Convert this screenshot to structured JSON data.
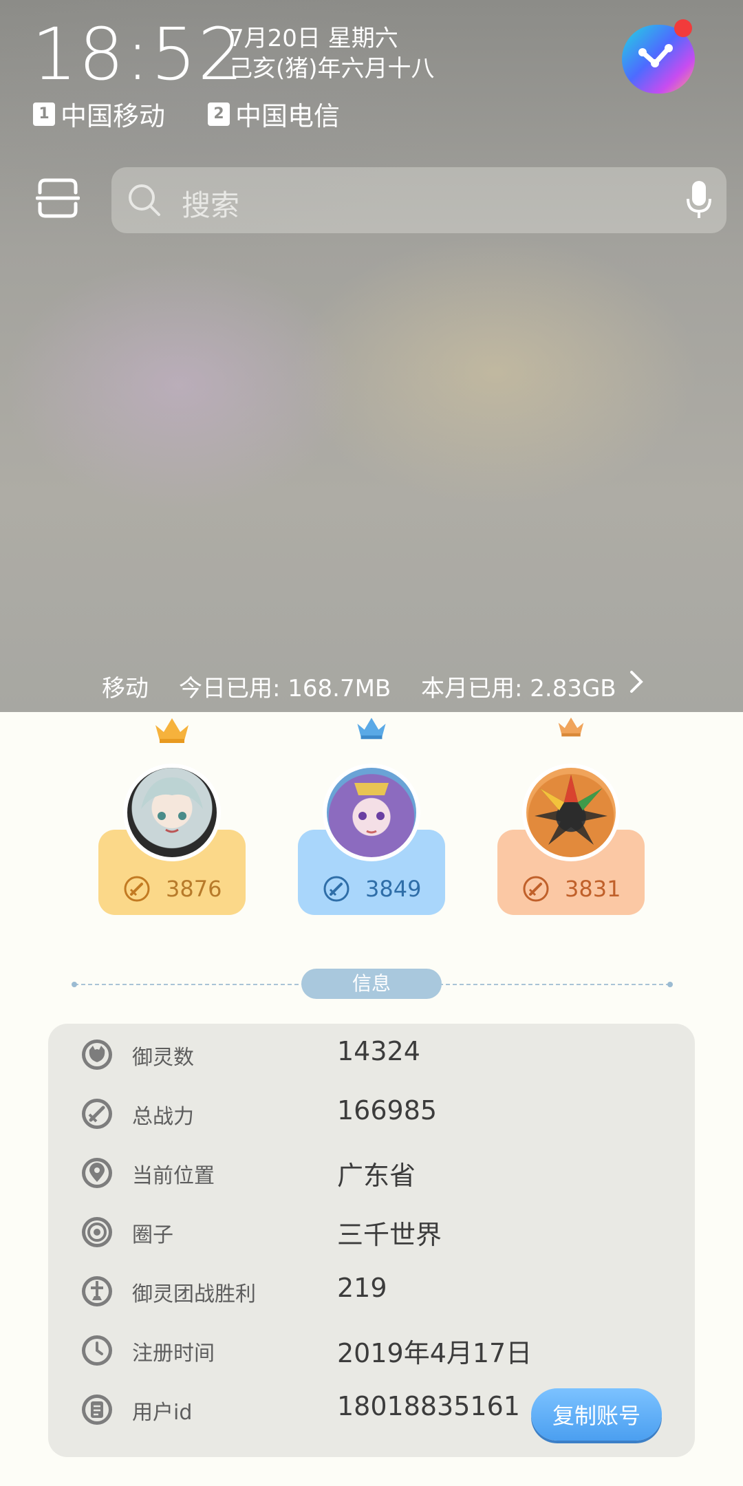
{
  "status": {
    "time": "18:52",
    "date": "7月20日 星期六",
    "lunar_date": "己亥(猪)年六月十八",
    "sim1_badge": "1",
    "sim1_carrier": "中国移动",
    "sim2_badge": "2",
    "sim2_carrier": "中国电信"
  },
  "search": {
    "placeholder": "搜索"
  },
  "usage": {
    "carrier": "移动",
    "today": "今日已用: 168.7MB",
    "month": "本月已用: 2.83GB"
  },
  "ranking": [
    {
      "power": "3876",
      "color": "#fbd889",
      "crown": "gold"
    },
    {
      "power": "3849",
      "color": "#a9d6fb",
      "crown": "blue"
    },
    {
      "power": "3831",
      "color": "#fbc8a4",
      "crown": "bronze"
    }
  ],
  "info": {
    "title": "信息",
    "rows": [
      {
        "icon": "spirit-icon",
        "label": "御灵数",
        "value": "14324"
      },
      {
        "icon": "sword-icon",
        "label": "总战力",
        "value": "166985"
      },
      {
        "icon": "location-pin-icon",
        "label": "当前位置",
        "value": "广东省"
      },
      {
        "icon": "circle-icon",
        "label": "圈子",
        "value": "三千世界"
      },
      {
        "icon": "trophy-icon",
        "label": "御灵团战胜利",
        "value": "219"
      },
      {
        "icon": "clock-icon",
        "label": "注册时间",
        "value": "2019年4月17日"
      },
      {
        "icon": "id-card-icon",
        "label": "用户id",
        "value": "18018835161"
      }
    ],
    "copy_button": "复制账号"
  }
}
